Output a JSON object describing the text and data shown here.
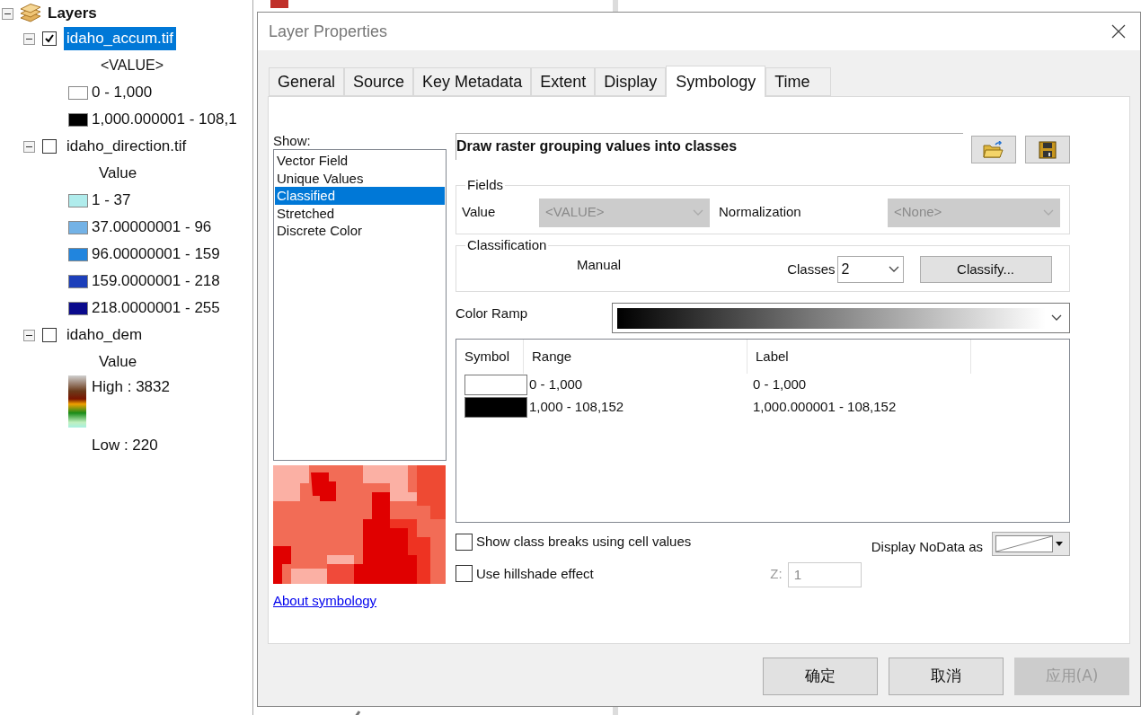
{
  "toc": {
    "root": "Layers",
    "layers": [
      {
        "name": "idaho_accum.tif",
        "checked": true,
        "selected": true,
        "expanded": true,
        "field": "<VALUE>",
        "kind": "classes",
        "legend": [
          {
            "label": "0 - 1,000",
            "color": "#ffffff"
          },
          {
            "label": "1,000.000001 - 108,1",
            "color": "#000000"
          }
        ]
      },
      {
        "name": "idaho_direction.tif",
        "checked": false,
        "selected": false,
        "expanded": true,
        "field": "Value",
        "kind": "classes",
        "legend": [
          {
            "label": "1 - 37",
            "color": "#b0ecec"
          },
          {
            "label": "37.00000001 - 96",
            "color": "#73b2e6"
          },
          {
            "label": "96.00000001 - 159",
            "color": "#2185de"
          },
          {
            "label": "159.0000001 - 218",
            "color": "#1c3fba"
          },
          {
            "label": "218.0000001 - 255",
            "color": "#0a0a8c"
          }
        ]
      },
      {
        "name": "idaho_dem",
        "checked": false,
        "selected": false,
        "expanded": true,
        "field": "Value",
        "kind": "stretch",
        "high": "High : 3832",
        "low": "Low : 220"
      }
    ]
  },
  "dialog": {
    "title": "Layer Properties",
    "tabs": [
      {
        "label": "General",
        "selected": false
      },
      {
        "label": "Source",
        "selected": false
      },
      {
        "label": "Key Metadata",
        "selected": false
      },
      {
        "label": "Extent",
        "selected": false
      },
      {
        "label": "Display",
        "selected": false
      },
      {
        "label": "Symbology",
        "selected": true
      },
      {
        "label": "Time",
        "selected": false
      }
    ],
    "show_label": "Show:",
    "show_list": [
      {
        "label": "Vector Field",
        "selected": false
      },
      {
        "label": "Unique Values",
        "selected": false
      },
      {
        "label": "Classified",
        "selected": true
      },
      {
        "label": "Stretched",
        "selected": false
      },
      {
        "label": "Discrete Color",
        "selected": false
      }
    ],
    "about_link": "About symbology",
    "description": "Draw raster grouping values into classes",
    "fields": {
      "title": "Fields",
      "value_label": "Value",
      "value_select": {
        "value": "<VALUE>",
        "disabled": true
      },
      "normalization_label": "Normalization",
      "normalization_select": {
        "value": "<None>",
        "disabled": true
      }
    },
    "classification": {
      "title": "Classification",
      "method": "Manual",
      "classes_label": "Classes",
      "classes_value": "2",
      "classify_button": "Classify..."
    },
    "color_ramp_label": "Color Ramp",
    "table": {
      "columns": [
        "Symbol",
        "Range",
        "Label"
      ],
      "rows": [
        {
          "color": "#ffffff",
          "range": "0 - 1,000",
          "label": "0 - 1,000"
        },
        {
          "color": "#000000",
          "range": "1,000 - 108,152",
          "label": "1,000.000001 - 108,152"
        }
      ]
    },
    "checkboxes": [
      {
        "label": "Show class breaks using cell values",
        "checked": false
      },
      {
        "label": "Use hillshade effect",
        "checked": false
      }
    ],
    "z_label": "Z:",
    "z_value": "1",
    "nodata_label": "Display NoData as",
    "buttons": [
      {
        "label": "确定",
        "disabled": false
      },
      {
        "label": "取消",
        "disabled": false
      },
      {
        "label": "应用(A)",
        "disabled": true
      }
    ]
  }
}
